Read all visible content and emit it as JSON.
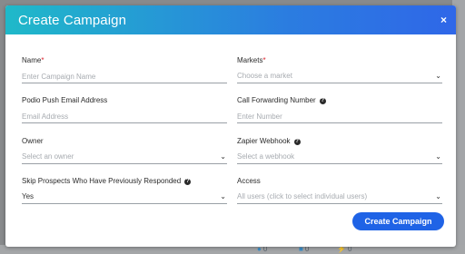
{
  "modal": {
    "title": "Create Campaign",
    "close_symbol": "×",
    "submit_label": "Create Campaign"
  },
  "fields": {
    "name": {
      "label": "Name",
      "required_mark": "*",
      "placeholder": "Enter Campaign Name"
    },
    "markets": {
      "label": "Markets",
      "required_mark": "*",
      "value": "Choose a market"
    },
    "podio": {
      "label": "Podio Push Email Address",
      "placeholder": "Email Address"
    },
    "call_forwarding": {
      "label": "Call Forwarding Number",
      "placeholder": "Enter Number"
    },
    "owner": {
      "label": "Owner",
      "value": "Select an owner"
    },
    "zapier": {
      "label": "Zapier Webhook",
      "value": "Select a webhook"
    },
    "skip": {
      "label": "Skip Prospects Who Have Previously Responded",
      "value": "Yes"
    },
    "access": {
      "label": "Access",
      "value": "All users (click to select individual users)"
    }
  },
  "background": {
    "stat_1": "0",
    "stat_2": "0",
    "stat_3": "0"
  },
  "colors": {
    "header_gradient_start": "#1fb9c9",
    "header_gradient_end": "#2f67e8",
    "primary_button": "#1f63e6",
    "required": "#d9232e"
  },
  "icons": {
    "close": "close-icon",
    "help": "help-circle-icon",
    "dropdown": "chevron-down-icon"
  }
}
